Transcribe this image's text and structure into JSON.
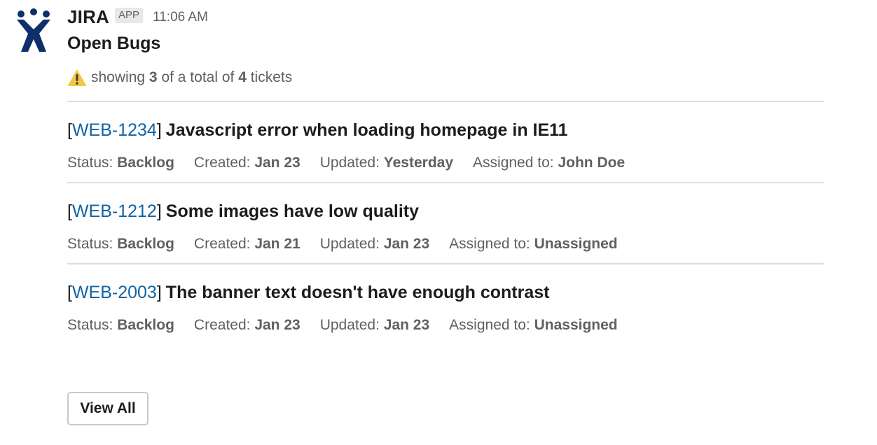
{
  "app": {
    "name": "JIRA",
    "badge": "APP",
    "timestamp": "11:06 AM",
    "brand_color": "#0d2f6b"
  },
  "message": {
    "title": "Open Bugs",
    "warning": {
      "icon": "warning-icon",
      "prefix": "showing",
      "shown": "3",
      "middle": "of a total of",
      "total": "4",
      "suffix": "tickets"
    }
  },
  "labels": {
    "status": "Status:",
    "created": "Created:",
    "updated": "Updated:",
    "assigned": "Assigned to:",
    "open_bracket": "[",
    "close_bracket": "]"
  },
  "tickets": [
    {
      "key": "WEB-1234",
      "summary": "Javascript error when loading homepage in IE11",
      "status": "Backlog",
      "created": "Jan 23",
      "updated": "Yesterday",
      "assignee": "John Doe"
    },
    {
      "key": "WEB-1212",
      "summary": "Some images have low quality",
      "status": "Backlog",
      "created": "Jan 21",
      "updated": "Jan 23",
      "assignee": "Unassigned"
    },
    {
      "key": "WEB-2003",
      "summary": "The banner text doesn't have enough contrast",
      "status": "Backlog",
      "created": "Jan 23",
      "updated": "Jan 23",
      "assignee": "Unassigned"
    }
  ],
  "actions": {
    "view_all_label": "View All"
  },
  "colors": {
    "link": "#1264a3",
    "muted": "#616061",
    "divider": "#dddddd",
    "warning": "#f2c744"
  }
}
